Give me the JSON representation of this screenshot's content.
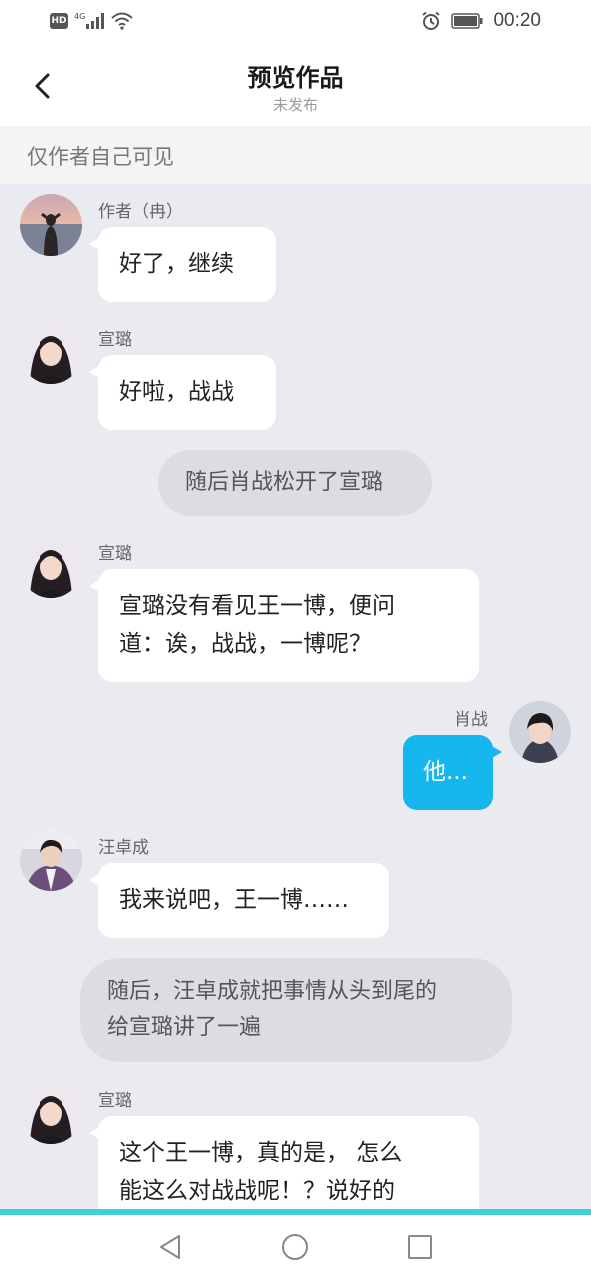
{
  "status_bar": {
    "hd_badge": "HD",
    "network": "4G",
    "time": "00:20",
    "icons": [
      "hd-icon",
      "signal-icon",
      "wifi-icon",
      "alarm-icon",
      "battery-icon"
    ]
  },
  "header": {
    "title": "预览作品",
    "subtitle": "未发布",
    "back_icon": "back-arrow-icon"
  },
  "notice": "仅作者自己可见",
  "messages": [
    {
      "type": "left",
      "sender": "作者（冉）",
      "text": "好了，继续"
    },
    {
      "type": "left",
      "sender": "宣璐",
      "text": "好啦，战战"
    },
    {
      "type": "narration",
      "text": "随后肖战松开了宣璐"
    },
    {
      "type": "left",
      "sender": "宣璐",
      "lines": [
        "宣璐没有看见王一博，便问",
        "道：诶，战战，一博呢？"
      ]
    },
    {
      "type": "right",
      "sender": "肖战",
      "text": "他..."
    },
    {
      "type": "left",
      "sender": "汪卓成",
      "text": "我来说吧，王一博……"
    },
    {
      "type": "narration",
      "lines": [
        "随后，汪卓成就把事情从头到尾的",
        "给宣璐讲了一遍"
      ]
    },
    {
      "type": "left",
      "sender": "宣璐",
      "lines": [
        "这个王一博，真的是， 怎么",
        "能这么对战战呢！？说好的"
      ]
    }
  ],
  "nav": {
    "icons": [
      "nav-back-icon",
      "nav-home-icon",
      "nav-recents-icon"
    ]
  },
  "colors": {
    "background": "#e9ebf0",
    "bubble_blue": "#16b6ef",
    "narration_bg": "#dbdde3",
    "nav_line": "#3fd0dd"
  }
}
